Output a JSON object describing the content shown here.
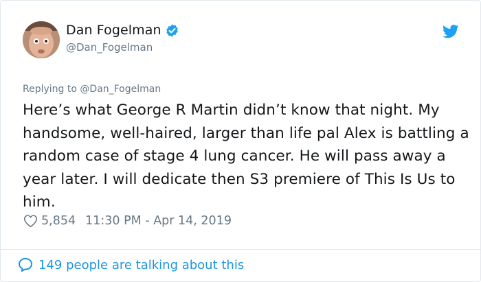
{
  "author": {
    "name": "Dan Fogelman",
    "handle": "@Dan_Fogelman"
  },
  "reply_to": "Replying to @Dan_Fogelman",
  "tweet_text": "Here’s what George R Martin didn’t know that night. My handsome, well-haired, larger than life pal Alex is battling a random case of stage 4 lung cancer.  He will pass away a year later. I will dedicate then S3 premiere of This Is Us to him.",
  "likes": "5,854",
  "timestamp": "11:30 PM - Apr 14, 2019",
  "talking": "149 people are talking about this",
  "icons": {
    "verified": "verified-badge-icon",
    "brand": "twitter-bird-icon",
    "like": "heart-icon",
    "reply": "speech-bubble-icon"
  },
  "colors": {
    "accent": "#1b95e0",
    "secondary_text": "#657786",
    "primary_text": "#14171a",
    "border": "#e1e8ed"
  }
}
